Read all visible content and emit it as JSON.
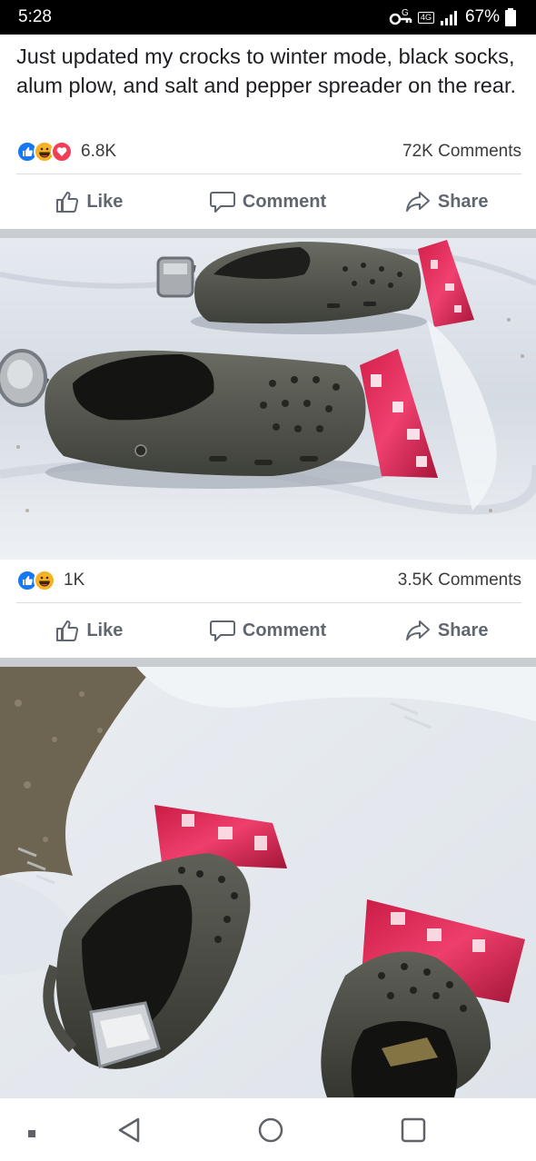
{
  "status_bar": {
    "time": "5:28",
    "lte_label": "4G",
    "battery_percent": "67%",
    "icons": [
      "vpn-key-icon",
      "lte-icon",
      "signal-icon",
      "battery-icon"
    ]
  },
  "post": {
    "text": "Just updated my crocks to winter mode, black socks, alum plow, and salt and pepper  spreader on the rear.",
    "reactions": {
      "icons": [
        "like-icon",
        "haha-icon",
        "love-icon"
      ],
      "count": "6.8K"
    },
    "comments": "72K Comments",
    "actions": {
      "like": "Like",
      "comment": "Comment",
      "share": "Share"
    }
  },
  "photo1": {
    "alt_subject": "crocs-with-foil-plow",
    "reactions": {
      "icons": [
        "like-icon",
        "haha-icon"
      ],
      "count": "1K"
    },
    "comments": "3.5K Comments",
    "actions": {
      "like": "Like",
      "comment": "Comment",
      "share": "Share"
    }
  },
  "photo2": {
    "alt_subject": "crocs-in-snow-rear-view"
  },
  "nav": {
    "icons": [
      "recents-dot-icon",
      "back-icon",
      "home-icon",
      "overview-icon"
    ]
  },
  "colors": {
    "like_blue": "#1877f2",
    "haha_yellow": "#f7b125",
    "love_red": "#f33e58",
    "divider": "#dadde1",
    "band": "#c9ccd1"
  }
}
